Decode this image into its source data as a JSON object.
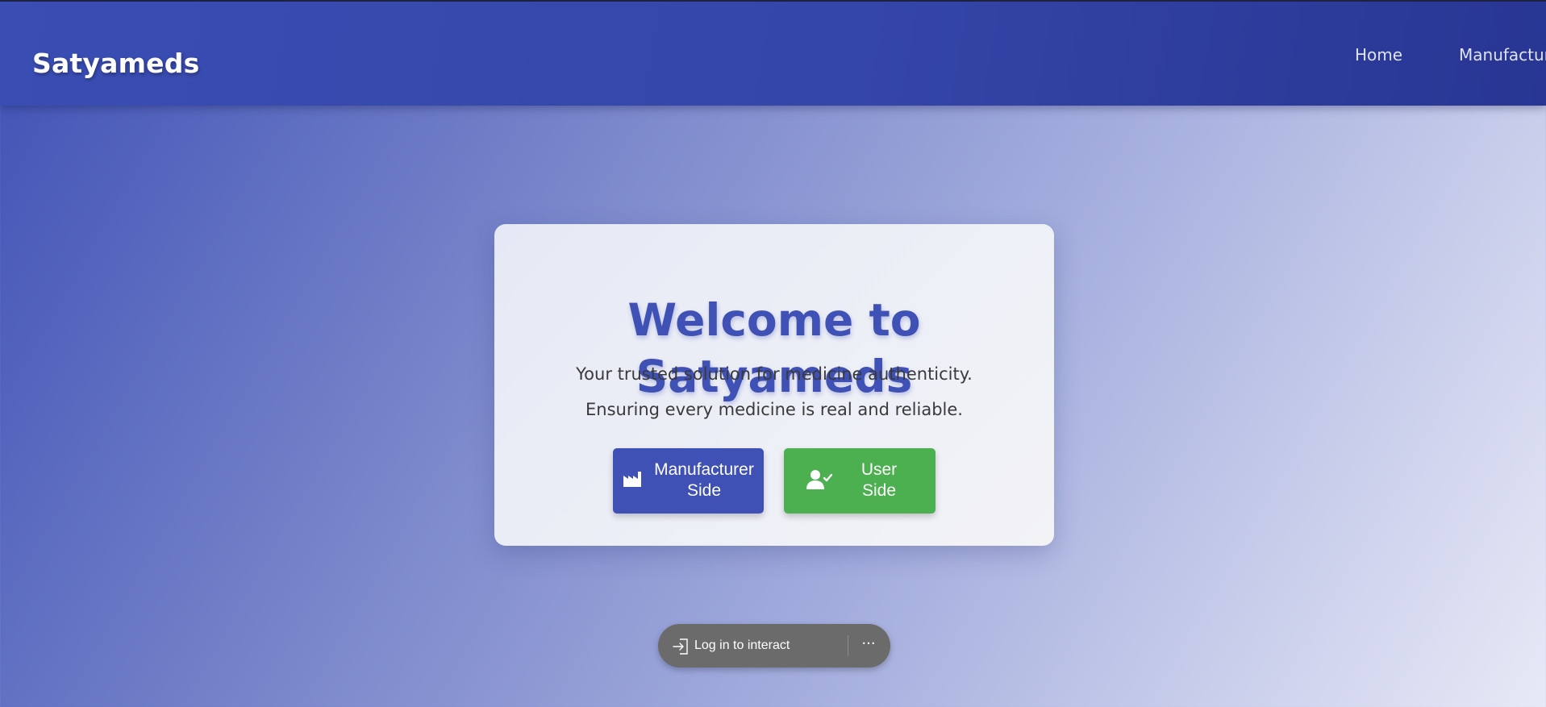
{
  "brand": "Satyameds",
  "nav": {
    "home": "Home",
    "manufacturer": "Manufacturer"
  },
  "hero": {
    "title": "Welcome to Satyameds",
    "subtitle1": "Your trusted solution for medicine authenticity.",
    "subtitle2": "Ensuring every medicine is real and reliable.",
    "manufacturer_button": {
      "line1": "Manufacturer",
      "line2": "Side",
      "icon": "factory-icon"
    },
    "user_button": {
      "line1": "User",
      "line2": "Side",
      "icon": "user-check-icon"
    }
  },
  "overlay": {
    "login_label": "Log in to interact",
    "login_icon": "sign-in-icon",
    "more_label": "···"
  },
  "colors": {
    "primary": "#3f51b5",
    "header": "#3446a8",
    "success": "#4caf50",
    "pill": "#6b6b6b"
  }
}
